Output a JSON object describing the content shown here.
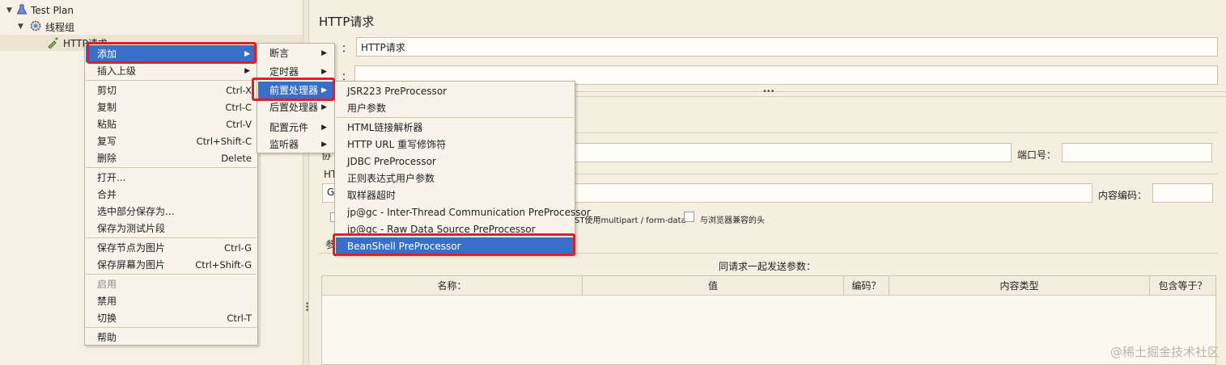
{
  "tree": {
    "test_plan": "Test Plan",
    "thread_group": "线程组",
    "http_request": "HTTP请求"
  },
  "right": {
    "title": "HTTP请求",
    "name_value": "HTTP请求",
    "name_label": "：",
    "comment_label": "：",
    "protocol_label": "协",
    "port_label": "端口号：",
    "http_label": "HT",
    "method_value": "G",
    "content_encoding_label": "内容编码：",
    "multipart_label": "ST使用multipart / form-data",
    "browser_headers_label": "与浏览器兼容的头",
    "params_tab": "参",
    "params_caption": "同请求一起发送参数：",
    "table_headers": [
      "名称：",
      "值",
      "编码？",
      "内容类型",
      "包含等于？"
    ]
  },
  "menu1": {
    "items": [
      {
        "label": "添加",
        "accel": "",
        "arrow": true
      },
      {
        "label": "插入上级",
        "accel": "",
        "arrow": true
      },
      {
        "label": "剪切",
        "accel": "Ctrl-X"
      },
      {
        "label": "复制",
        "accel": "Ctrl-C"
      },
      {
        "label": "粘贴",
        "accel": "Ctrl-V"
      },
      {
        "label": "复写",
        "accel": "Ctrl+Shift-C"
      },
      {
        "label": "删除",
        "accel": "Delete"
      },
      {
        "label": "打开...",
        "accel": ""
      },
      {
        "label": "合并",
        "accel": ""
      },
      {
        "label": "选中部分保存为...",
        "accel": ""
      },
      {
        "label": "保存为测试片段",
        "accel": ""
      },
      {
        "label": "保存节点为图片",
        "accel": "Ctrl-G"
      },
      {
        "label": "保存屏幕为图片",
        "accel": "Ctrl+Shift-G"
      },
      {
        "label": "启用",
        "accel": ""
      },
      {
        "label": "禁用",
        "accel": ""
      },
      {
        "label": "切换",
        "accel": "Ctrl-T"
      },
      {
        "label": "帮助",
        "accel": ""
      }
    ]
  },
  "menu2": {
    "items": [
      {
        "label": "断言"
      },
      {
        "label": "定时器"
      },
      {
        "label": "前置处理器"
      },
      {
        "label": "后置处理器"
      },
      {
        "label": "配置元件"
      },
      {
        "label": "监听器"
      }
    ]
  },
  "menu3": {
    "items": [
      {
        "label": "JSR223 PreProcessor"
      },
      {
        "label": "用户参数"
      },
      {
        "label": "HTML链接解析器"
      },
      {
        "label": "HTTP URL 重写修饰符"
      },
      {
        "label": "JDBC PreProcessor"
      },
      {
        "label": "正则表达式用户参数"
      },
      {
        "label": "取样器超时"
      },
      {
        "label": "jp@gc - Inter-Thread Communication PreProcessor"
      },
      {
        "label": "jp@gc - Raw Data Source PreProcessor"
      },
      {
        "label": "BeanShell PreProcessor"
      }
    ]
  },
  "watermark": "@稀土掘金技术社区",
  "colors": {
    "selection": "#3a6fc9",
    "highlight_box": "#e02020",
    "background": "#f5efe1"
  }
}
